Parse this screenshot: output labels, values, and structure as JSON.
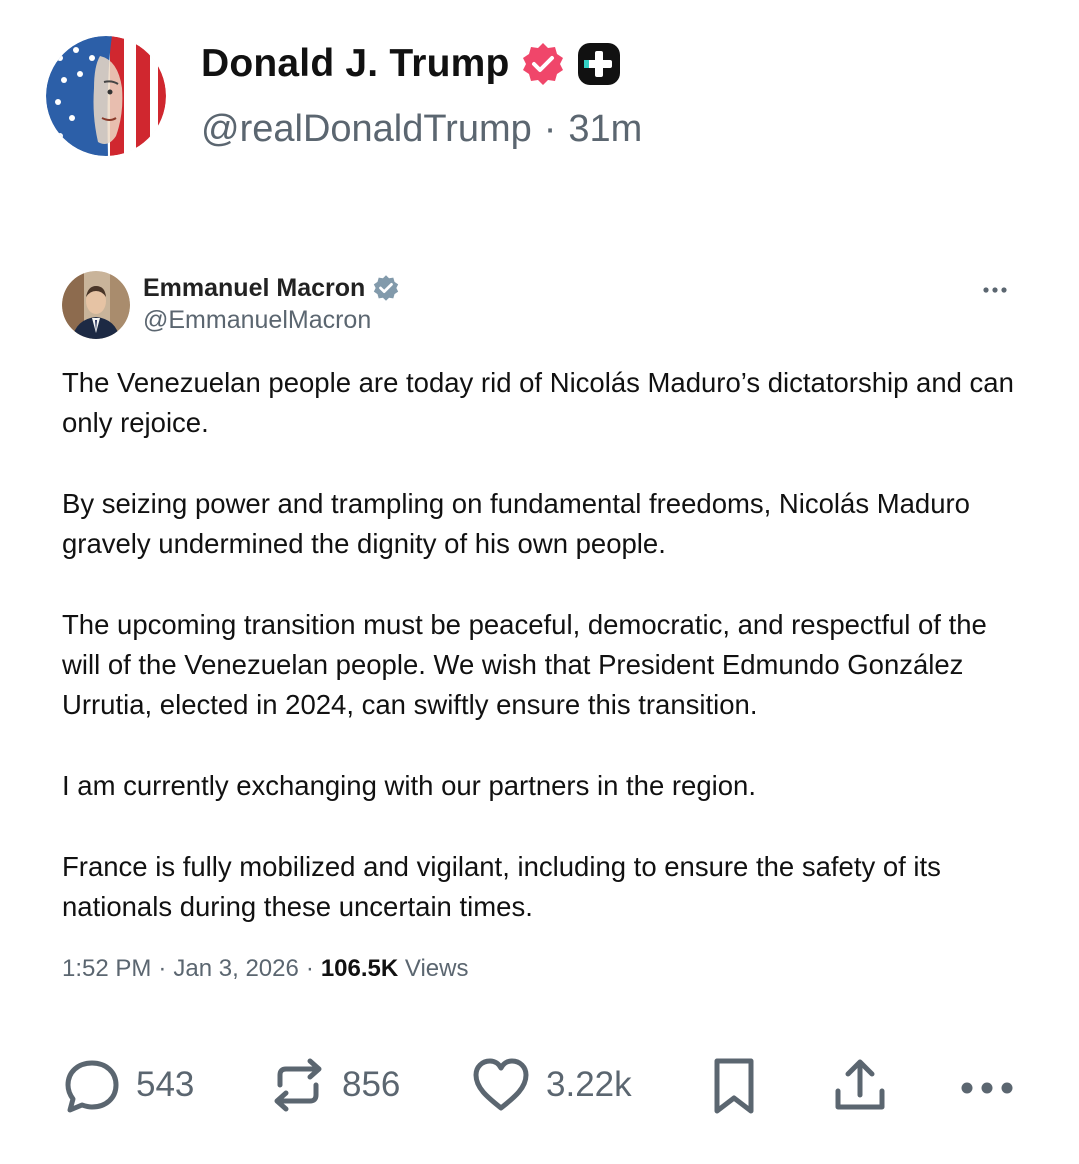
{
  "post": {
    "author_name": "Donald J. Trump",
    "author_handle": "@realDonaldTrump",
    "separator": "·",
    "time_ago": "31m",
    "verified_icon": "verified-badge-icon",
    "extra_badge_icon": "plus-badge-icon",
    "colors": {
      "verified_badge": "#f0466a",
      "handle": "#5b6670",
      "text": "#111111"
    }
  },
  "quoted_post": {
    "author_name": "Emmanuel Macron",
    "author_handle": "@EmmanuelMacron",
    "verified_icon": "verified-badge-icon",
    "more_icon": "more-options-icon",
    "paragraphs": [
      "The Venezuelan people are today rid of Nicolás Maduro’s dictatorship and can only rejoice.",
      "By seizing power and trampling on fundamental freedoms, Nicolás Maduro gravely undermined the dignity of his own people.",
      "The upcoming transition must be peaceful, democratic, and respectful of the will of the Venezuelan people. We wish that President Edmundo González Urrutia, elected in 2024, can swiftly ensure this transition.",
      "I am currently exchanging with our partners in the region.",
      "France is fully mobilized and vigilant, including to ensure the safety of its nationals during these uncertain times."
    ],
    "time": "1:52 PM",
    "date": "Jan 3, 2026",
    "separator": "·",
    "views_count": "106.5K",
    "views_label": "Views",
    "colors": {
      "verified_badge": "#829aab"
    }
  },
  "actions": {
    "reply": {
      "icon": "reply-icon",
      "count": "543"
    },
    "repost": {
      "icon": "repost-icon",
      "count": "856"
    },
    "like": {
      "icon": "heart-icon",
      "count": "3.22k"
    },
    "bookmark": {
      "icon": "bookmark-icon"
    },
    "share": {
      "icon": "share-icon"
    },
    "more": {
      "icon": "more-options-icon"
    },
    "icon_color": "#5b6670"
  }
}
